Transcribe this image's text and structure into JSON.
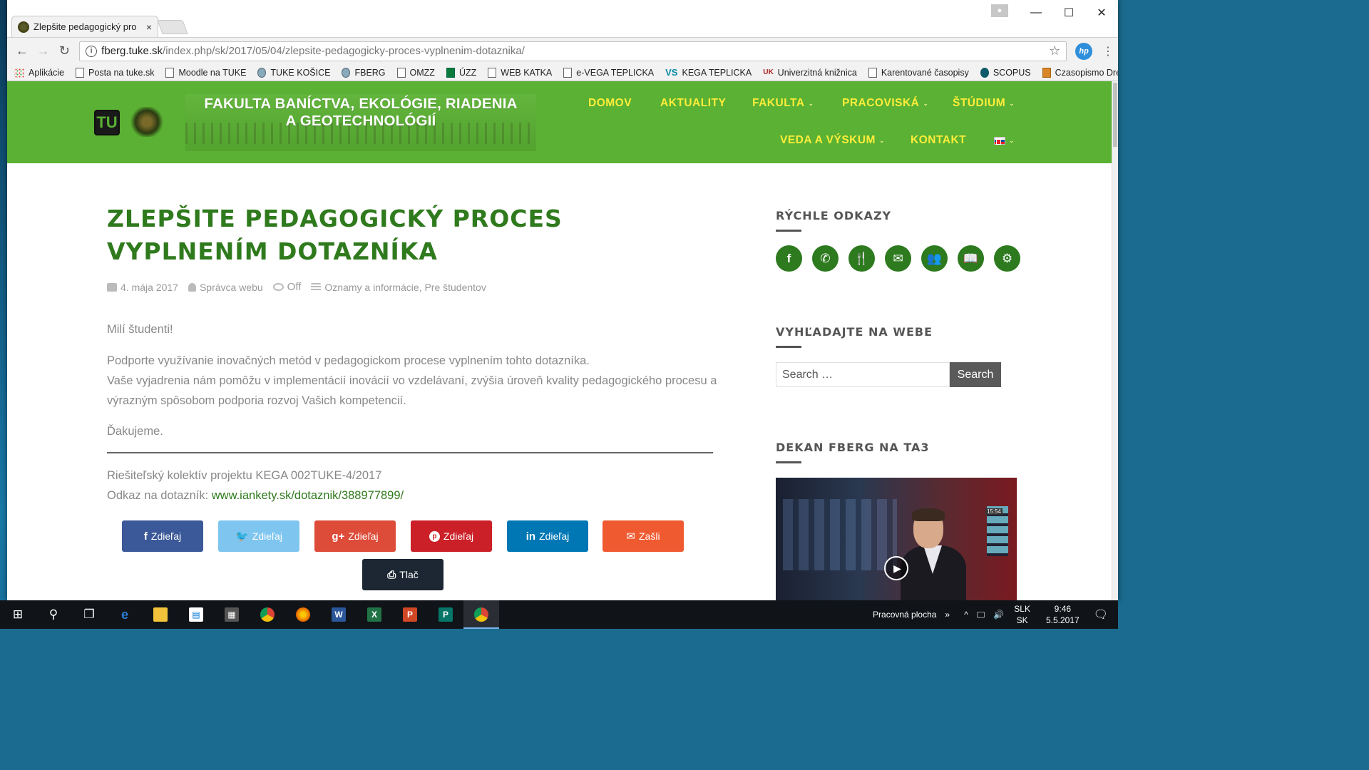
{
  "browser": {
    "tab_title": "Zlepšite pedagogický pro",
    "tab_close": "×",
    "url_domain": "fberg.tuke.sk",
    "url_path": "/index.php/sk/2017/05/04/zlepsite-pedagogicky-proces-vyplnenim-dotaznika/",
    "window_minimize": "—",
    "window_maximize": "☐",
    "window_close": "✕",
    "back": "←",
    "forward": "→",
    "reload": "↻",
    "star": "☆",
    "ext_label": "hp",
    "menu": "⋮",
    "bookmarks_more": "»"
  },
  "bookmarks": [
    {
      "label": "Aplikácie",
      "icon": "apps-icon"
    },
    {
      "label": "Posta na tuke.sk",
      "icon": "page-icon"
    },
    {
      "label": "Moodle na TUKE",
      "icon": "page-icon"
    },
    {
      "label": "TUKE KOŠICE",
      "icon": "globe-icon"
    },
    {
      "label": "FBERG",
      "icon": "globe-icon"
    },
    {
      "label": "OMZZ",
      "icon": "page-icon"
    },
    {
      "label": "ÚZZ",
      "icon": "green-icon"
    },
    {
      "label": "WEB KATKA",
      "icon": "page-icon"
    },
    {
      "label": "e-VEGA TEPLICKA",
      "icon": "page-icon"
    },
    {
      "label": "KEGA TEPLICKA",
      "icon": "vs-icon"
    },
    {
      "label": "Univerzitná knižnica",
      "icon": "uk-icon"
    },
    {
      "label": "Karentované časopisy",
      "icon": "page-icon"
    },
    {
      "label": "SCOPUS",
      "icon": "scopus-icon"
    },
    {
      "label": "Czasopismo Drewno",
      "icon": "drewno-icon"
    }
  ],
  "site": {
    "logo_tu": "TU",
    "title_line1": "FAKULTA BANÍCTVA, EKOLÓGIE, RIADENIA",
    "title_line2": "A GEOTECHNOLÓGIÍ",
    "nav": {
      "domov": "DOMOV",
      "aktuality": "AKTUALITY",
      "fakulta": "FAKULTA",
      "pracoviska": "PRACOVISKÁ",
      "studium": "ŠTÚDIUM",
      "veda": "VEDA A VÝSKUM",
      "kontakt": "KONTAKT"
    },
    "caret": "⌄",
    "brand_color": "#5ab133",
    "nav_color": "#ffed3a"
  },
  "article": {
    "title": "ZLEPŠITE PEDAGOGICKÝ PROCES VYPLNENÍM DOTAZNÍKA",
    "date": "4. mája 2017",
    "author": "Správca webu",
    "comments": "Off",
    "categories": "Oznamy a informácie, Pre študentov",
    "p1": "Milí študenti!",
    "p2_line1": "Podporte využívanie inovačných metód v pedagogickom procese vyplnením tohto dotazníka.",
    "p2_line2": "Vaše vyjadrenia nám pomôžu v implementácií inovácií vo vzdelávaní, zvýšia úroveň kvality pedagogického procesu a",
    "p2_line3": "výrazným spôsobom podporia rozvoj Vašich kompetencií.",
    "p3": "Ďakujeme.",
    "footer_line1": "Riešiteľský kolektív projektu KEGA 002TUKE-4/2017",
    "footer_link_label": "Odkaz na dotazník: ",
    "footer_link": "www.iankety.sk/dotaznik/388977899/",
    "title_color": "#2f7a1d"
  },
  "share": [
    {
      "label": "Zdieľaj",
      "icon": "f",
      "color": "#3b5998",
      "name": "facebook"
    },
    {
      "label": "Zdieľaj",
      "icon": "🐦",
      "color": "#7ec5f0",
      "name": "twitter"
    },
    {
      "label": "Zdieľaj",
      "icon": "g+",
      "color": "#dd4b39",
      "name": "googleplus"
    },
    {
      "label": "Zdieľaj",
      "icon": "p",
      "color": "#cb2027",
      "name": "pinterest"
    },
    {
      "label": "Zdieľaj",
      "icon": "in",
      "color": "#0077b5",
      "name": "linkedin"
    },
    {
      "label": "Zašli",
      "icon": "✉",
      "color": "#f05a30",
      "name": "email"
    },
    {
      "label": "Tlač",
      "icon": "⎙",
      "color": "#1c2733",
      "name": "print"
    }
  ],
  "sidebar": {
    "quick_links_title": "RÝCHLE ODKAZY",
    "quick_links": [
      {
        "icon": "f",
        "name": "facebook-icon"
      },
      {
        "icon": "✆",
        "name": "phone-icon"
      },
      {
        "icon": "🍴",
        "name": "food-icon"
      },
      {
        "icon": "✉",
        "name": "mail-icon"
      },
      {
        "icon": "👥",
        "name": "people-icon"
      },
      {
        "icon": "📖",
        "name": "book-icon"
      },
      {
        "icon": "⚙",
        "name": "gears-icon"
      }
    ],
    "search_title": "VYHĽADAJTE NA WEBE",
    "search_placeholder": "Search …",
    "search_button": "Search",
    "video_title": "DEKAN FBERG NA TA3",
    "video_clock": "15:54"
  },
  "taskbar": {
    "desktop_label": "Pracovná plocha",
    "lang_top": "SLK",
    "lang_bottom": "SK",
    "time": "9:46",
    "date": "5.5.2017",
    "more": "»",
    "chevron": "^"
  }
}
